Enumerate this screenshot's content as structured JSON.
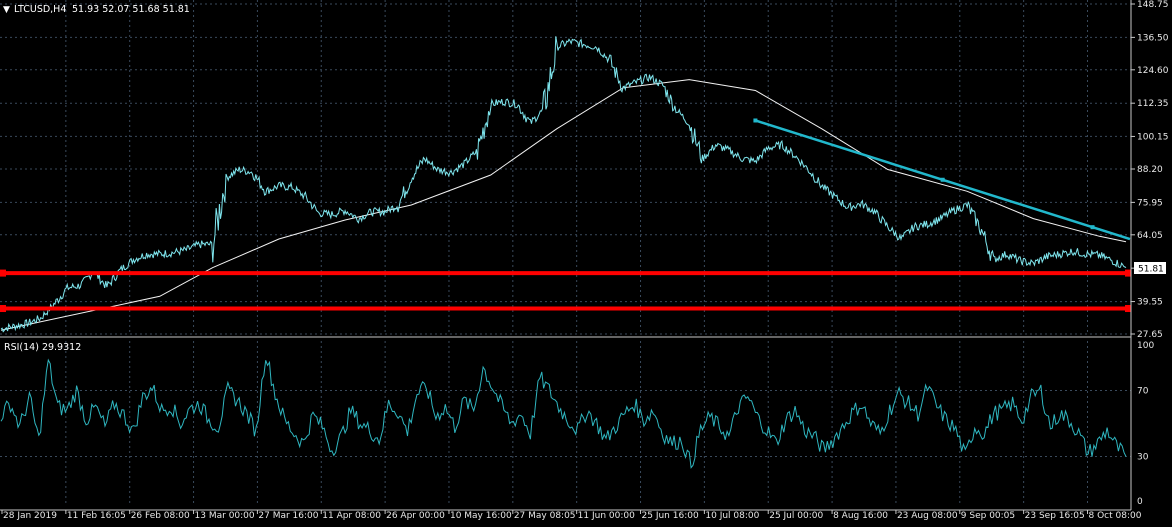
{
  "window": {
    "symbol_label": "LTCUSD,H4",
    "ohlc_label": "51.93 52.07 51.68 51.81",
    "collapse_icon": "triangle-down-icon"
  },
  "colors": {
    "background": "#000000",
    "grid": "#3a4a5c",
    "price": "#7fe6ee",
    "moving_average": "#f2f2f2",
    "trendline": "#22b8cc",
    "support": "#ff0000",
    "rsi": "#2fb6c0",
    "axis_text": "#e8e8e8",
    "price_marker_bg": "#ffffff",
    "price_marker_text": "#000000"
  },
  "chart_data": [
    {
      "type": "line",
      "panel": "price",
      "title": "LTCUSD,H4",
      "ylim": [
        27.65,
        148.75
      ],
      "y_ticks": [
        "148.75",
        "136.50",
        "124.60",
        "112.35",
        "100.15",
        "88.20",
        "75.95",
        "64.05",
        "51.81",
        "39.55",
        "27.65"
      ],
      "x_ticks": [
        "28 Jan 2019",
        "11 Feb 16:05",
        "26 Feb 08:00",
        "13 Mar 00:00",
        "27 Mar 16:00",
        "11 Apr 08:00",
        "26 Apr 00:00",
        "10 May 16:00",
        "27 May 08:05",
        "11 Jun 00:00",
        "25 Jun 16:00",
        "10 Jul 08:00",
        "25 Jul 00:00",
        "8 Aug 16:00",
        "23 Aug 08:00",
        "9 Sep 00:05",
        "23 Sep 16:05",
        "8 Oct 08:00"
      ],
      "current_price": "51.81",
      "series": [
        {
          "role": "price",
          "x": [
            "28 Jan 2019",
            "31 Jan",
            "4 Feb",
            "8 Feb",
            "11 Feb 16:05",
            "15 Feb",
            "19 Feb",
            "23 Feb",
            "26 Feb 08:00",
            "2 Mar",
            "6 Mar",
            "9 Mar",
            "13 Mar 00:00",
            "17 Mar",
            "21 Mar",
            "24 Mar",
            "27 Mar 16:00",
            "29 Mar",
            "1 Apr",
            "4 Apr",
            "7 Apr",
            "11 Apr 08:00",
            "14 Apr",
            "17 Apr",
            "20 Apr",
            "23 Apr",
            "26 Apr 00:00",
            "29 Apr",
            "2 May",
            "5 May",
            "8 May",
            "10 May 16:00",
            "13 May",
            "15 May",
            "18 May",
            "21 May",
            "24 May",
            "27 May 08:05",
            "29 May",
            "1 Jun",
            "4 Jun",
            "7 Jun",
            "11 Jun 00:00",
            "14 Jun",
            "17 Jun",
            "20 Jun",
            "23 Jun",
            "25 Jun 16:00",
            "28 Jun",
            "1 Jul",
            "4 Jul",
            "7 Jul",
            "10 Jul 08:00",
            "13 Jul",
            "16 Jul",
            "19 Jul",
            "22 Jul",
            "25 Jul 00:00",
            "28 Jul",
            "31 Jul",
            "3 Aug",
            "6 Aug",
            "8 Aug 16:00",
            "11 Aug",
            "14 Aug",
            "17 Aug",
            "20 Aug",
            "23 Aug 08:00",
            "26 Aug",
            "29 Aug",
            "1 Sep",
            "4 Sep",
            "6 Sep",
            "9 Sep 00:05",
            "12 Sep",
            "15 Sep",
            "18 Sep",
            "21 Sep",
            "23 Sep 16:05",
            "26 Sep",
            "29 Sep",
            "2 Oct",
            "5 Oct",
            "8 Oct 08:00",
            "11 Oct",
            "14 Oct"
          ],
          "values": [
            29.5,
            30.5,
            31.5,
            33.5,
            38.5,
            44.5,
            45.5,
            50.5,
            45.0,
            51.0,
            55.0,
            57.0,
            57.0,
            57.5,
            58.5,
            60.5,
            60.5,
            85.0,
            88.0,
            87.0,
            80.0,
            82.0,
            81.5,
            78.0,
            72.0,
            71.5,
            73.0,
            70.0,
            72.5,
            72.5,
            75.0,
            85.0,
            92.0,
            88.0,
            87.0,
            90.0,
            95.0,
            112.0,
            113.0,
            112.0,
            105.0,
            110.0,
            133.0,
            135.0,
            134.0,
            133.0,
            128.0,
            118.0,
            120.0,
            122.0,
            119.0,
            110.0,
            105.0,
            92.0,
            97.0,
            95.0,
            92.0,
            91.0,
            96.0,
            97.0,
            93.0,
            88.0,
            82.0,
            78.0,
            74.0,
            75.5,
            72.5,
            67.0,
            62.5,
            67.0,
            68.0,
            70.0,
            73.0,
            75.0,
            66.5,
            55.0,
            57.0,
            54.5,
            53.5,
            56.0,
            57.0,
            58.0,
            57.0,
            56.5,
            54.5,
            52.0
          ]
        },
        {
          "role": "moving_average",
          "x": [
            "28 Jan 2019",
            "13 Mar 00:00",
            "27 Mar 16:00",
            "11 Apr 08:00",
            "26 Apr 00:00",
            "10 May 16:00",
            "27 May 08:05",
            "11 Jun 00:00",
            "25 Jun 16:00",
            "10 Jul 08:00",
            "25 Jul 00:00",
            "8 Aug 16:00",
            "23 Aug 08:00",
            "9 Sep 00:05",
            "23 Sep 16:05",
            "8 Oct 08:00",
            "14 Oct"
          ],
          "values": [
            29.0,
            41.5,
            52.0,
            62.5,
            69.5,
            75.0,
            86.0,
            103.0,
            118.0,
            121.0,
            117.0,
            103.0,
            88.0,
            80.0,
            70.0,
            63.5,
            61.5
          ]
        }
      ],
      "annotations": [
        {
          "type": "trendline",
          "x": [
            "25 Jul 00:00",
            "14 Oct"
          ],
          "values": [
            106.0,
            62.5
          ]
        },
        {
          "type": "horizontal_line",
          "value": 50.0
        },
        {
          "type": "horizontal_line",
          "value": 37.0
        }
      ]
    },
    {
      "type": "line",
      "panel": "oscillator",
      "title": "RSI(14) 29.9312",
      "ylim": [
        0,
        100
      ],
      "y_ticks": [
        "100",
        "70",
        "30",
        "0"
      ],
      "series": [
        {
          "role": "rsi",
          "values": [
            55,
            62,
            48,
            66,
            40,
            88,
            60,
            58,
            70,
            52,
            60,
            48,
            62,
            55,
            45,
            66,
            72,
            58,
            61,
            50,
            59,
            62,
            52,
            48,
            70,
            64,
            56,
            45,
            93,
            68,
            52,
            44,
            38,
            55,
            48,
            34,
            42,
            58,
            50,
            46,
            40,
            62,
            57,
            45,
            68,
            72,
            54,
            60,
            48,
            64,
            58,
            84,
            72,
            60,
            50,
            56,
            44,
            78,
            70,
            60,
            52,
            46,
            58,
            50,
            40,
            48,
            56,
            62,
            52,
            58,
            44,
            38,
            40,
            25,
            46,
            54,
            48,
            42,
            60,
            66,
            54,
            46,
            38,
            52,
            58,
            46,
            42,
            34,
            40,
            48,
            56,
            62,
            50,
            44,
            58,
            68,
            62,
            56,
            72,
            60,
            52,
            46,
            30,
            48,
            44,
            56,
            58,
            62,
            52,
            66,
            70,
            48,
            56,
            52,
            44,
            32,
            38,
            46,
            36,
            30
          ]
        }
      ]
    }
  ]
}
